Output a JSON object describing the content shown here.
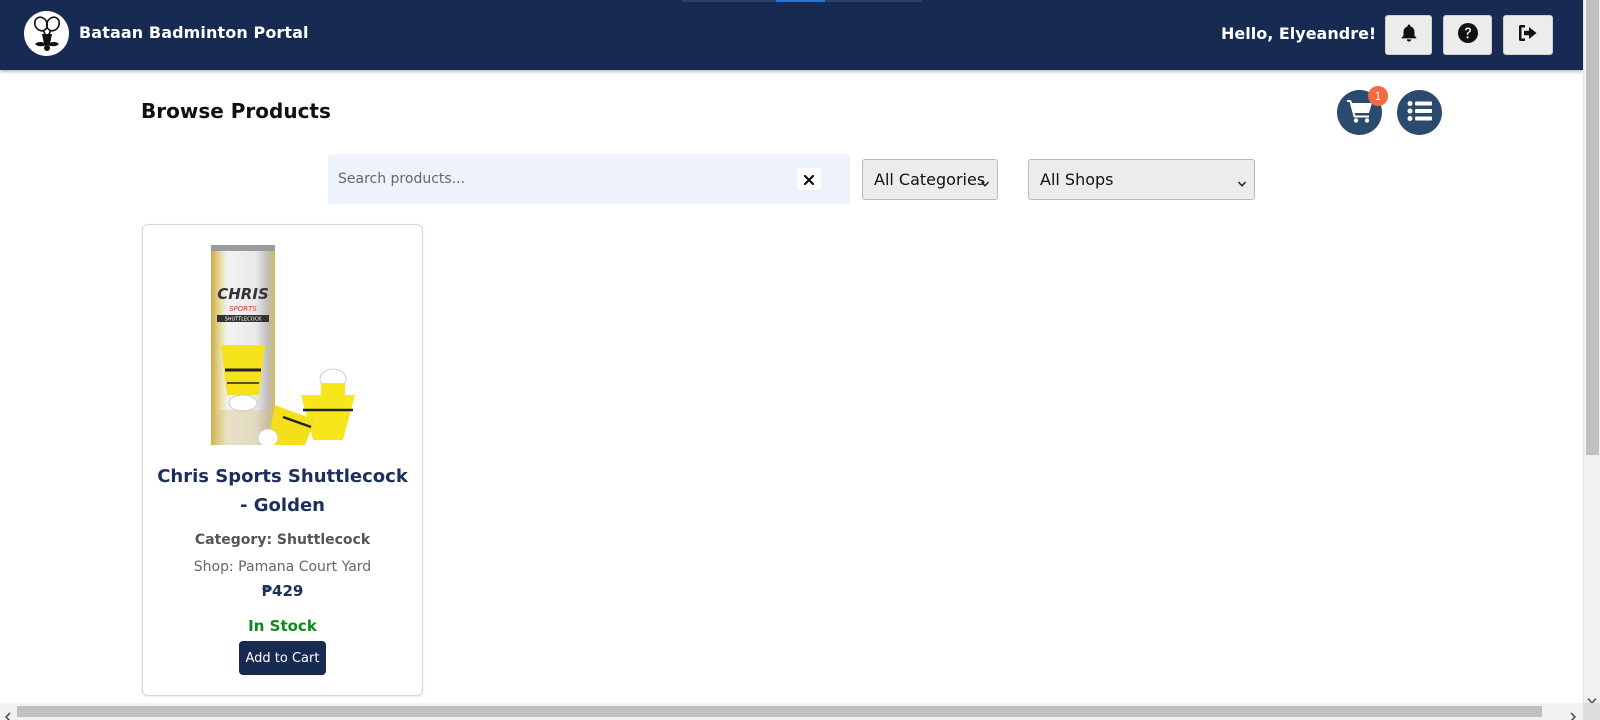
{
  "header": {
    "brand": "Bataan Badminton Portal",
    "greeting": "Hello, Elyeandre!",
    "logo_icon": "badminton-mustache-logo",
    "buttons": [
      {
        "name": "notifications",
        "icon": "bell-icon"
      },
      {
        "name": "help",
        "icon": "question-circle-icon"
      },
      {
        "name": "logout",
        "icon": "sign-out-icon"
      }
    ],
    "background_color": "#172a52"
  },
  "page": {
    "title": "Browse Products",
    "cart": {
      "icon": "shopping-cart-icon",
      "badge_count": "1"
    },
    "list_icon": "list-icon"
  },
  "filters": {
    "search": {
      "placeholder": "Search products...",
      "value": "",
      "clear_icon": "close-icon"
    },
    "category": {
      "selected": "All Categories"
    },
    "shop": {
      "selected": "All Shops"
    }
  },
  "products": [
    {
      "name": "Chris Sports Shuttlecock - Golden",
      "category": "Category: Shuttlecock",
      "shop": "Shop: Pamana Court Yard",
      "price": "₱429",
      "stock": "In Stock",
      "add_label": "Add to Cart",
      "image_text": "CHRIS SPORTS SHUTTLECOCK"
    }
  ],
  "colors": {
    "primary": "#172a52",
    "in_stock": "#0b8a17",
    "badge": "#f26a3e",
    "circle_button": "#2a4a6e"
  }
}
